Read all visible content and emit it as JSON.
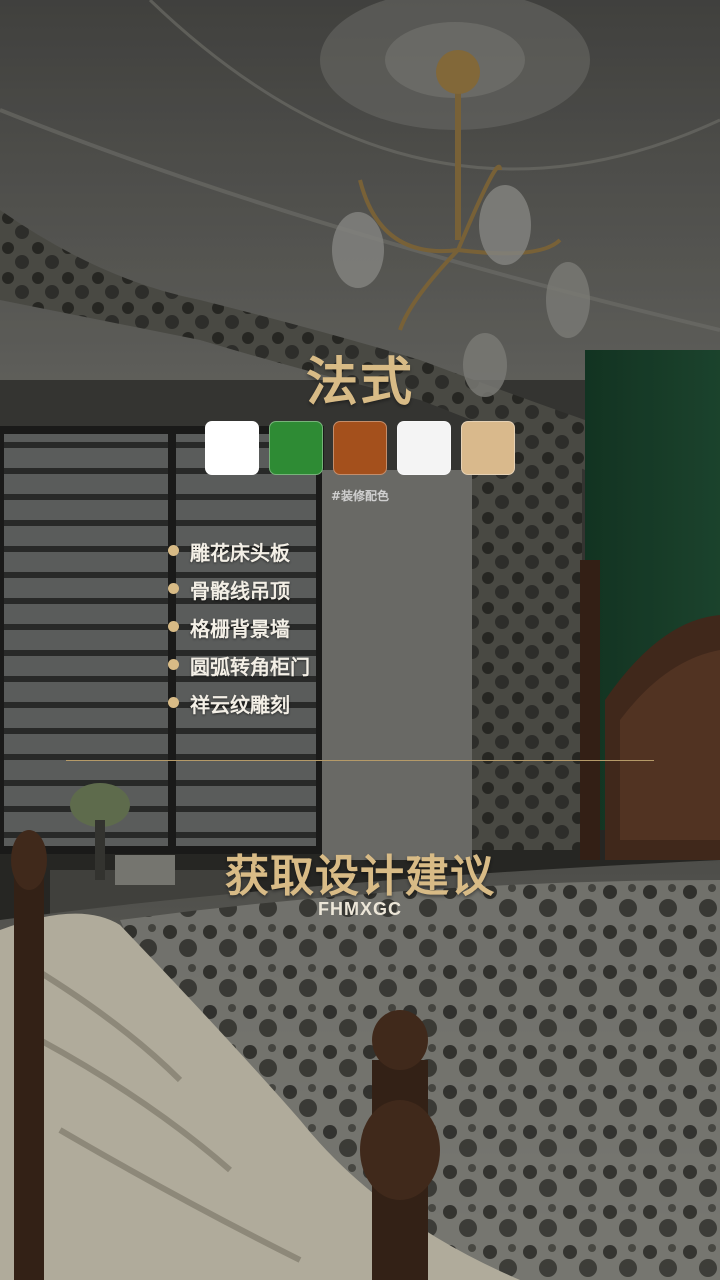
{
  "style_title": "法式",
  "palette": [
    {
      "name": "white",
      "color": "#ffffff"
    },
    {
      "name": "green",
      "color": "#2e8b34"
    },
    {
      "name": "rust",
      "color": "#a4501c"
    },
    {
      "name": "off-white",
      "color": "#f4f4f4"
    },
    {
      "name": "beige",
      "color": "#d9b98c"
    }
  ],
  "hashtag": "#装修配色",
  "features": [
    "雕花床头板",
    "骨骼线吊顶",
    "格栅背景墙",
    "圆弧转角柜门",
    "祥云纹雕刻"
  ],
  "cta": "获取设计建议",
  "code": "FHMXGC"
}
